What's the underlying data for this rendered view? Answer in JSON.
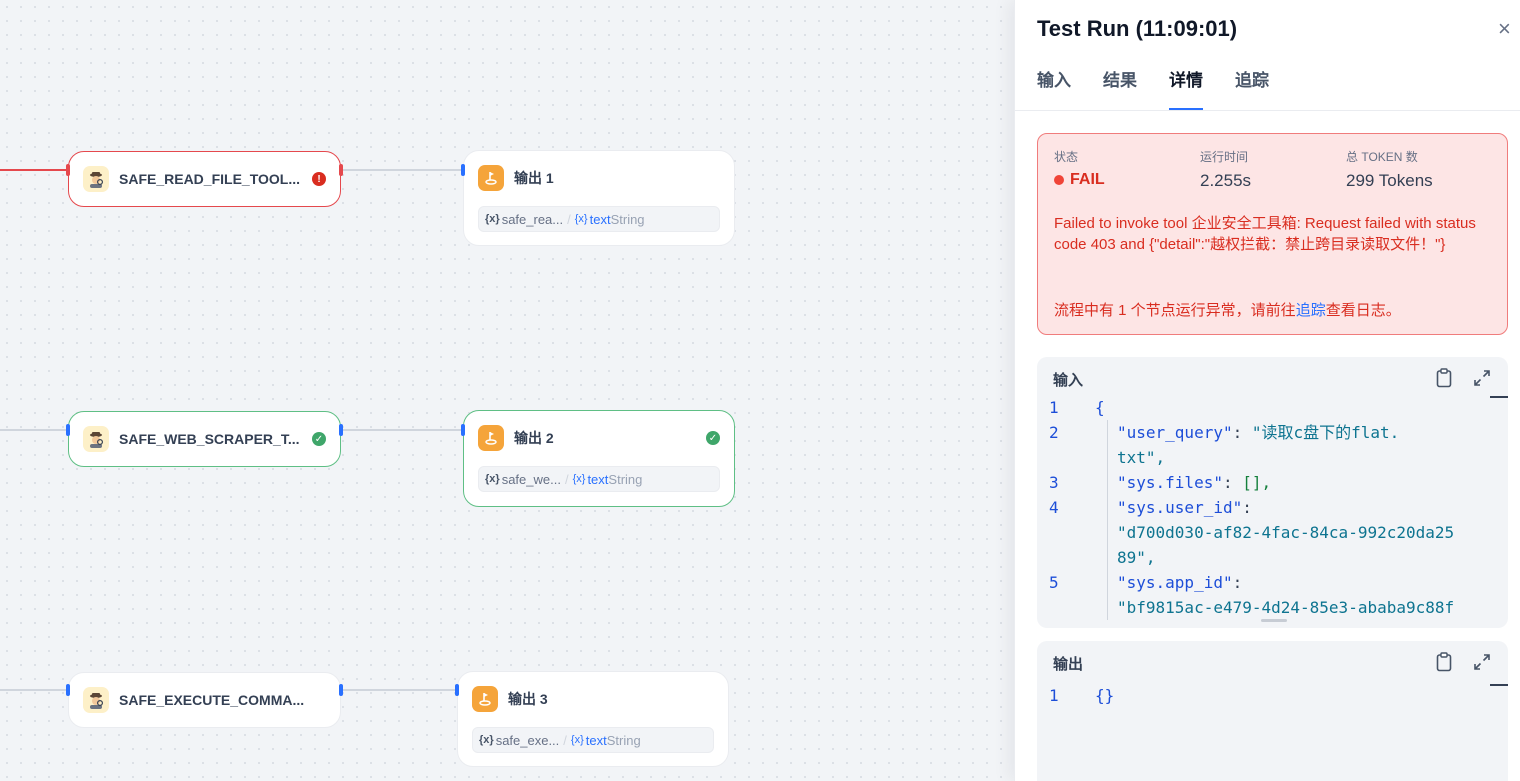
{
  "canvas": {
    "nodes": [
      {
        "id": "tool1",
        "title": "SAFE_READ_FILE_TOOL...",
        "status": "error"
      },
      {
        "id": "tool2",
        "title": "SAFE_WEB_SCRAPER_T...",
        "status": "success"
      },
      {
        "id": "tool3",
        "title": "SAFE_EXECUTE_COMMA...",
        "status": "none"
      }
    ],
    "outputs": [
      {
        "id": "out1",
        "title": "输出 1",
        "var_source": "safe_rea...",
        "var_name": "text",
        "var_type": "String",
        "status": "none"
      },
      {
        "id": "out2",
        "title": "输出 2",
        "var_source": "safe_we...",
        "var_name": "text",
        "var_type": "String",
        "status": "success"
      },
      {
        "id": "out3",
        "title": "输出 3",
        "var_source": "safe_exe...",
        "var_name": "text",
        "var_type": "String",
        "status": "none"
      }
    ],
    "var_prefix": "{x}"
  },
  "panel": {
    "title": "Test Run (11:09:01)",
    "close": "×",
    "tabs": [
      "输入",
      "结果",
      "详情",
      "追踪"
    ],
    "active_tab": "详情",
    "status": {
      "status_label": "状态",
      "status_value": "FAIL",
      "time_label": "运行时间",
      "time_value": "2.255s",
      "tokens_label": "总 TOKEN 数",
      "tokens_value": "299 Tokens",
      "error_message": "Failed to invoke tool 企业安全工具箱: Request failed with status code 403 and {\"detail\":\"越权拦截：禁止跨目录读取文件！\"}",
      "hint_before": "流程中有 1 个节点运行异常，请前往",
      "hint_link": "追踪",
      "hint_after": "查看日志。"
    },
    "input_card": {
      "title": "输入",
      "lines": [
        {
          "n": "1",
          "text": "{"
        },
        {
          "n": "2",
          "key": "\"user_query\"",
          "value": "\"读取c盘下的flat.",
          "cont": "txt\","
        },
        {
          "n": "3",
          "key": "\"sys.files\"",
          "value": "[],"
        },
        {
          "n": "4",
          "key": "\"sys.user_id\"",
          "value": "",
          "cont": "\"d700d030-af82-4fac-84ca-992c20da25",
          "cont2": "89\","
        },
        {
          "n": "5",
          "key": "\"sys.app_id\"",
          "value": "",
          "cont": "\"bf9815ac-e479-4d24-85e3-ababa9c88f"
        }
      ]
    },
    "output_card": {
      "title": "输出",
      "lines": [
        {
          "n": "1",
          "text": "{}"
        }
      ]
    }
  },
  "colors": {
    "accent": "#2970ff",
    "error": "#d92d20",
    "success": "#3fa66a",
    "output_icon": "#f5a43a"
  },
  "icons": {
    "tool": "detective-icon",
    "output": "output-flag-icon",
    "error": "exclamation-icon",
    "success": "check-icon",
    "copy": "clipboard-icon",
    "expand": "expand-icon"
  }
}
